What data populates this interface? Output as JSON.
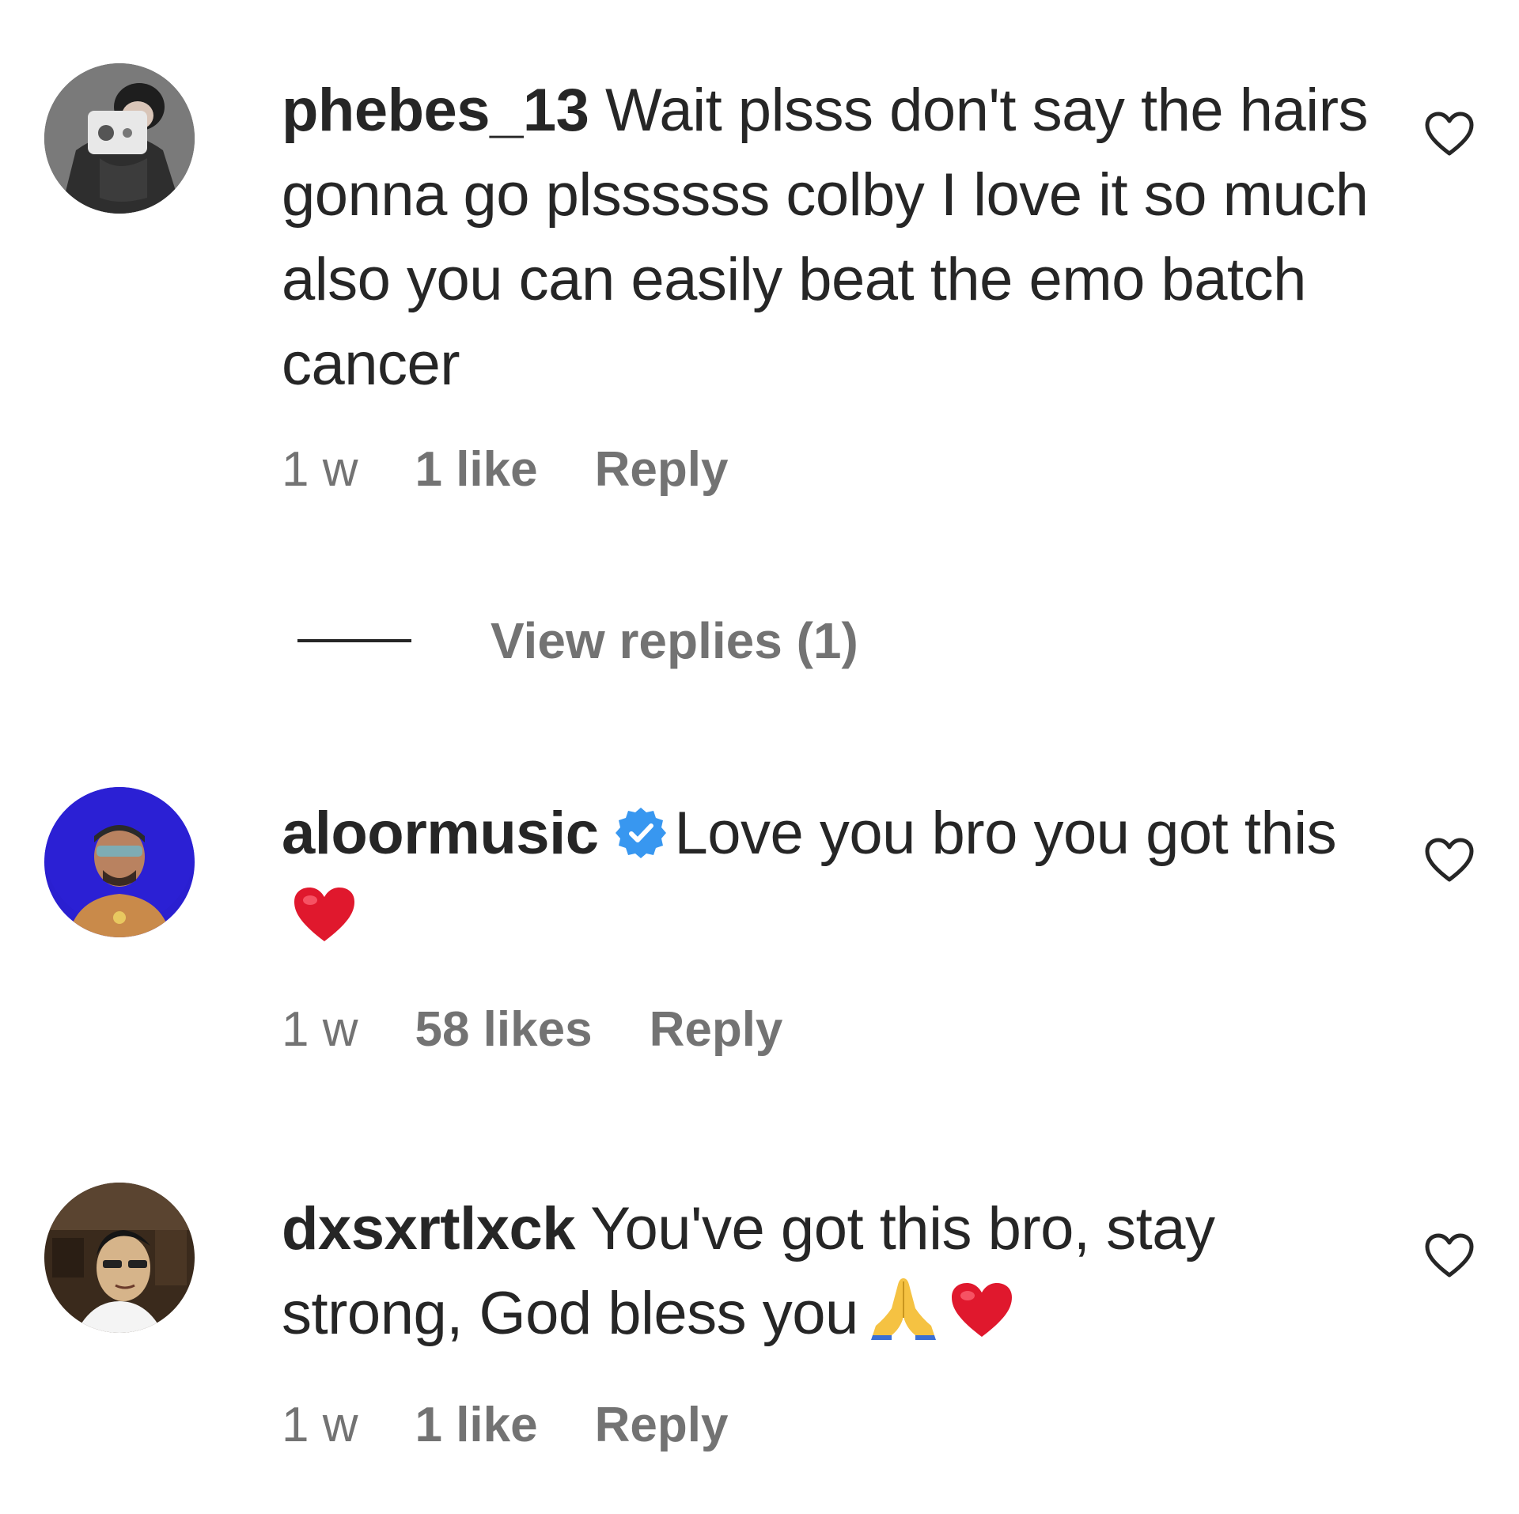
{
  "comments": [
    {
      "username": "phebes_13",
      "verified": false,
      "text": "Wait plsss don't say the hairs gonna go plssssss colby I love it so much also you can easily beat the emo batch cancer",
      "time": "1 w",
      "likes": "1 like",
      "reply_label": "Reply"
    },
    {
      "username": "aloormusic",
      "verified": true,
      "text": "Love you bro you got this",
      "time": "1 w",
      "likes": "58 likes",
      "reply_label": "Reply"
    },
    {
      "username": "dxsxrtlxck",
      "verified": false,
      "text": "You've got this bro, stay strong, God bless you",
      "time": "1 w",
      "likes": "1 like",
      "reply_label": "Reply"
    }
  ],
  "view_replies_label": "View replies (1)",
  "colors": {
    "text": "#262626",
    "secondary": "#737373",
    "verified": "#3897f0",
    "heart_emoji": "#e0182d"
  }
}
